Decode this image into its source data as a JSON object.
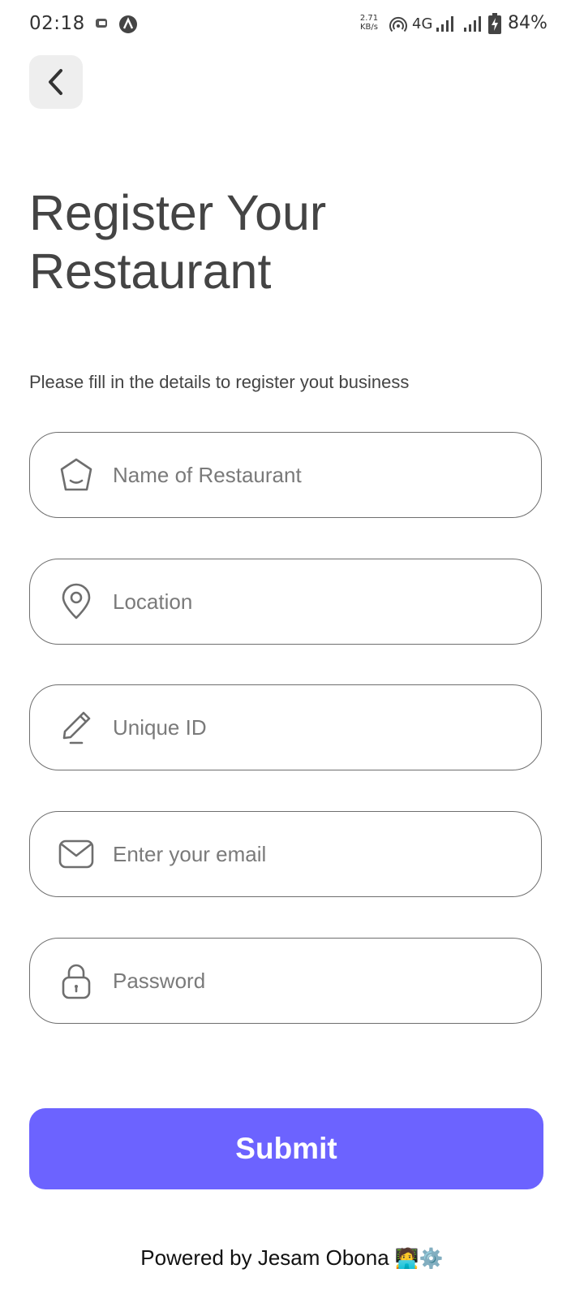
{
  "status_bar": {
    "time": "02:18",
    "net_speed_value": "2.71",
    "net_speed_unit": "KB/s",
    "network_type": "4G",
    "battery_percent": "84%",
    "icons": [
      "notification-icon",
      "app-logo-icon",
      "hotspot-icon",
      "signal-icon",
      "signal-icon",
      "battery-charging-icon"
    ]
  },
  "header": {
    "back_icon": "chevron-left-icon",
    "title_line1": "Register Your",
    "title_line2": "Restaurant",
    "subtitle": "Please fill in the details to register yout business"
  },
  "form": {
    "fields": [
      {
        "icon": "home-icon",
        "placeholder": "Name of Restaurant",
        "value": ""
      },
      {
        "icon": "location-pin-icon",
        "placeholder": "Location",
        "value": ""
      },
      {
        "icon": "pencil-icon",
        "placeholder": "Unique ID",
        "value": ""
      },
      {
        "icon": "mail-icon",
        "placeholder": "Enter your email",
        "value": ""
      },
      {
        "icon": "lock-icon",
        "placeholder": "Password",
        "value": ""
      }
    ],
    "submit_label": "Submit"
  },
  "footer": {
    "text": "Powered by Jesam Obona",
    "emoji": "🧑‍💻⚙️"
  },
  "colors": {
    "accent": "#6c63ff",
    "field_border": "#6e6e6e",
    "back_button_bg": "#eeeeee",
    "text": "#444444"
  }
}
